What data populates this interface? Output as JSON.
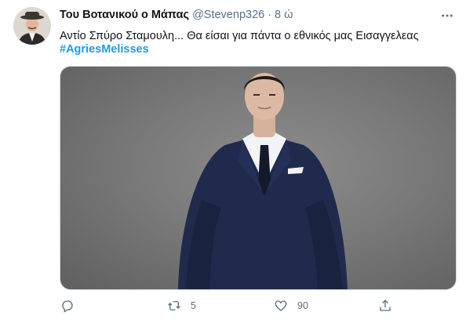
{
  "tweet": {
    "display_name": "Του Βοτανικού ο Μάπας",
    "handle": "@Stevenp326",
    "separator": "·",
    "time": "8 ώ",
    "text": "Αντίο Σπύρο Σταμουλη... Θα είσαι για πάντα ο εθνικός μας Εισαγγελεας",
    "hashtag": "#AgriesMelisses"
  },
  "actions": {
    "reply_count": "",
    "retweet_count": "5",
    "like_count": "90"
  },
  "colors": {
    "accent": "#1d9bf0",
    "muted": "#5b7083",
    "suit": "#1f2a4d"
  },
  "icons": {
    "more": "more-horizontal-icon",
    "reply": "reply-icon",
    "retweet": "retweet-icon",
    "like": "heart-icon",
    "share": "share-icon"
  }
}
